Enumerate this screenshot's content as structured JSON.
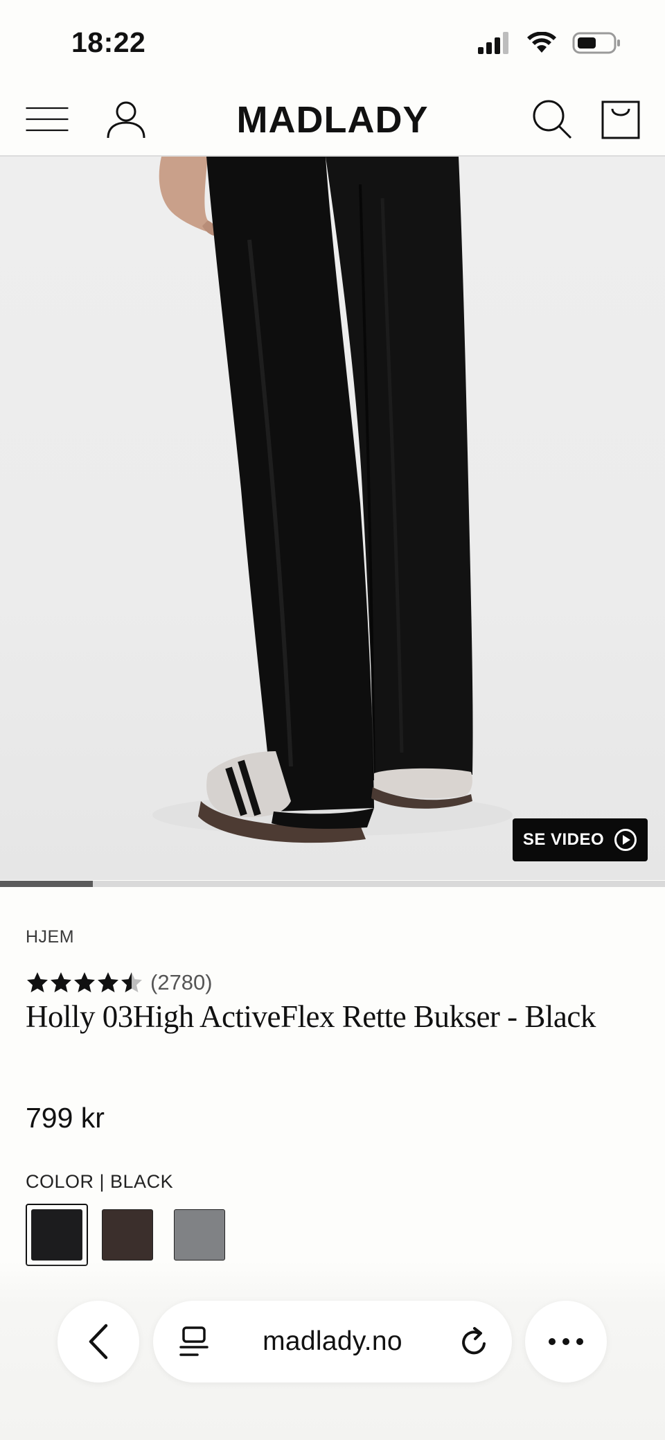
{
  "status_bar": {
    "time": "18:22"
  },
  "header": {
    "brand": "MADLADY",
    "icons": [
      "menu-icon",
      "account-icon",
      "search-icon",
      "cart-icon"
    ]
  },
  "hero": {
    "video_button_label": "SE VIDEO",
    "gallery_progress_fraction": 0.14
  },
  "product": {
    "breadcrumb": "HJEM",
    "rating_stars": 4.5,
    "review_count": "(2780)",
    "title": "Holly 03High ActiveFlex Rette Bukser - Black",
    "price": "799 kr",
    "color_label": "COLOR | BLACK",
    "swatches": [
      {
        "name": "black",
        "color": "#1c1c1e",
        "selected": true
      },
      {
        "name": "brown",
        "color": "#3b2f2c",
        "selected": false
      },
      {
        "name": "grey",
        "color": "#808285",
        "selected": false
      }
    ]
  },
  "browser": {
    "url": "madlady.no"
  }
}
